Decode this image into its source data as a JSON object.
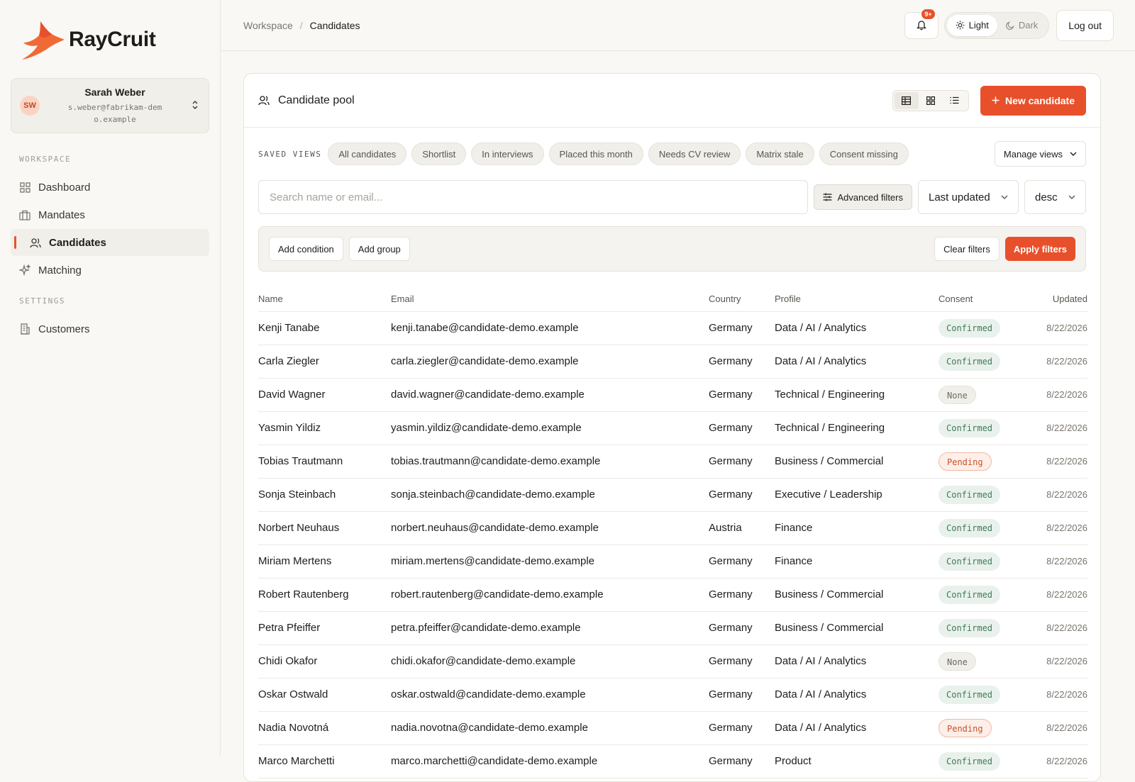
{
  "app": {
    "name": "RayCruit"
  },
  "user": {
    "initials": "SW",
    "name": "Sarah Weber",
    "email": "s.weber@fabrikam-demo.example"
  },
  "nav": {
    "workspace_label": "WORKSPACE",
    "settings_label": "SETTINGS",
    "items": [
      {
        "label": "Dashboard",
        "icon": "grid-icon"
      },
      {
        "label": "Mandates",
        "icon": "briefcase-icon"
      },
      {
        "label": "Candidates",
        "icon": "users-icon",
        "active": true
      },
      {
        "label": "Matching",
        "icon": "sparkles-icon"
      }
    ],
    "settings_items": [
      {
        "label": "Customers",
        "icon": "building-icon"
      }
    ]
  },
  "topbar": {
    "breadcrumb": [
      "Workspace",
      "Candidates"
    ],
    "notifications_badge": "9+",
    "theme": {
      "light": "Light",
      "dark": "Dark",
      "active": "light"
    },
    "logout": "Log out"
  },
  "panel": {
    "title": "Candidate pool",
    "new_button": "New candidate",
    "views_label": "SAVED VIEWS",
    "saved_views": [
      "All candidates",
      "Shortlist",
      "In interviews",
      "Placed this month",
      "Needs CV review",
      "Matrix stale",
      "Consent missing"
    ],
    "manage_views": "Manage views",
    "search_placeholder": "Search name or email...",
    "advanced_filters": "Advanced filters",
    "sort_field": "Last updated",
    "sort_dir": "desc",
    "add_condition": "Add condition",
    "add_group": "Add group",
    "clear_filters": "Clear filters",
    "apply_filters": "Apply filters"
  },
  "table": {
    "columns": [
      "Name",
      "Email",
      "Country",
      "Profile",
      "Consent",
      "Updated"
    ],
    "rows": [
      [
        "Kenji Tanabe",
        "kenji.tanabe@candidate-demo.example",
        "Germany",
        "Data / AI / Analytics",
        "Confirmed",
        "8/22/2026"
      ],
      [
        "Carla Ziegler",
        "carla.ziegler@candidate-demo.example",
        "Germany",
        "Data / AI / Analytics",
        "Confirmed",
        "8/22/2026"
      ],
      [
        "David Wagner",
        "david.wagner@candidate-demo.example",
        "Germany",
        "Technical / Engineering",
        "None",
        "8/22/2026"
      ],
      [
        "Yasmin Yildiz",
        "yasmin.yildiz@candidate-demo.example",
        "Germany",
        "Technical / Engineering",
        "Confirmed",
        "8/22/2026"
      ],
      [
        "Tobias Trautmann",
        "tobias.trautmann@candidate-demo.example",
        "Germany",
        "Business / Commercial",
        "Pending",
        "8/22/2026"
      ],
      [
        "Sonja Steinbach",
        "sonja.steinbach@candidate-demo.example",
        "Germany",
        "Executive / Leadership",
        "Confirmed",
        "8/22/2026"
      ],
      [
        "Norbert Neuhaus",
        "norbert.neuhaus@candidate-demo.example",
        "Austria",
        "Finance",
        "Confirmed",
        "8/22/2026"
      ],
      [
        "Miriam Mertens",
        "miriam.mertens@candidate-demo.example",
        "Germany",
        "Finance",
        "Confirmed",
        "8/22/2026"
      ],
      [
        "Robert Rautenberg",
        "robert.rautenberg@candidate-demo.example",
        "Germany",
        "Business / Commercial",
        "Confirmed",
        "8/22/2026"
      ],
      [
        "Petra Pfeiffer",
        "petra.pfeiffer@candidate-demo.example",
        "Germany",
        "Business / Commercial",
        "Confirmed",
        "8/22/2026"
      ],
      [
        "Chidi Okafor",
        "chidi.okafor@candidate-demo.example",
        "Germany",
        "Data / AI / Analytics",
        "None",
        "8/22/2026"
      ],
      [
        "Oskar Ostwald",
        "oskar.ostwald@candidate-demo.example",
        "Germany",
        "Data / AI / Analytics",
        "Confirmed",
        "8/22/2026"
      ],
      [
        "Nadia Novotná",
        "nadia.novotna@candidate-demo.example",
        "Germany",
        "Data / AI / Analytics",
        "Pending",
        "8/22/2026"
      ],
      [
        "Marco Marchetti",
        "marco.marchetti@candidate-demo.example",
        "Germany",
        "Product",
        "Confirmed",
        "8/22/2026"
      ]
    ]
  },
  "colors": {
    "accent": "#e8502b",
    "confirmed": "#3f7a55",
    "pending": "#c8512d"
  }
}
